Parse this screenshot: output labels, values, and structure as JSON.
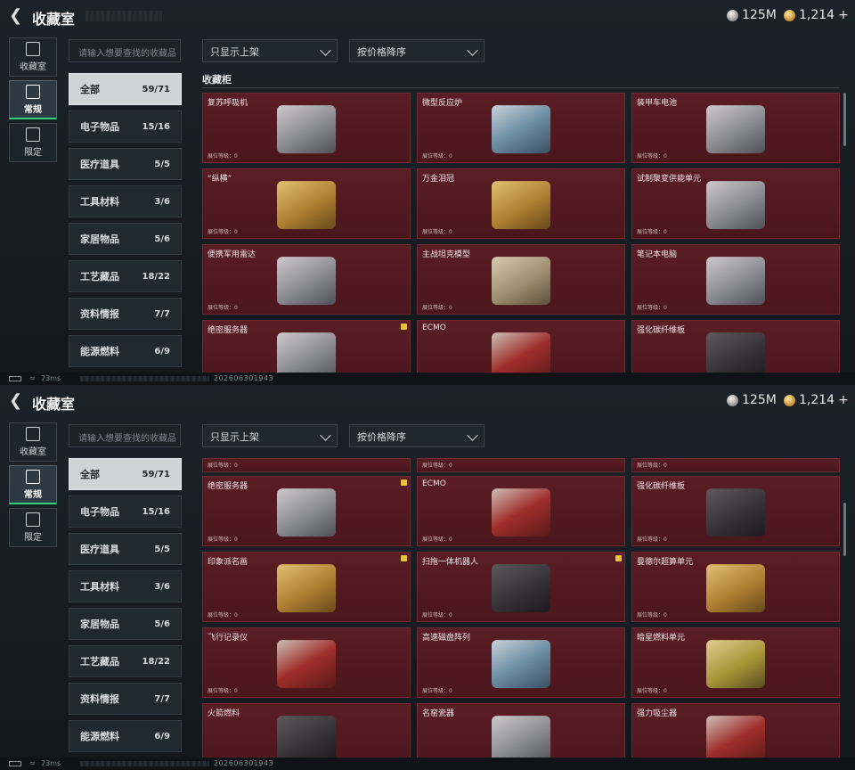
{
  "header": {
    "title": "收藏室",
    "silver": "125M",
    "gold": "1,214"
  },
  "rail": [
    {
      "label": "收藏室"
    },
    {
      "label": "常规"
    },
    {
      "label": "限定"
    }
  ],
  "search": {
    "placeholder": "请输入想要查找的收藏品"
  },
  "filters": {
    "shelf": "只显示上架",
    "sort": "按价格降序"
  },
  "categories": [
    {
      "name": "全部",
      "count": "59/71"
    },
    {
      "name": "电子物品",
      "count": "15/16"
    },
    {
      "name": "医疗道具",
      "count": "5/5"
    },
    {
      "name": "工具材料",
      "count": "3/6"
    },
    {
      "name": "家居物品",
      "count": "5/6"
    },
    {
      "name": "工艺藏品",
      "count": "18/22"
    },
    {
      "name": "资料情报",
      "count": "7/7"
    },
    {
      "name": "能源燃料",
      "count": "6/9"
    }
  ],
  "cabinet_label": "收藏柜",
  "level_label": "展位等级：0",
  "top_items": [
    "复苏呼吸机",
    "微型反应炉",
    "装甲车电池",
    "“纵横”",
    "万金泪冠",
    "试制聚变供能单元",
    "便携军用雷达",
    "主战坦克模型",
    "笔记本电脑",
    "绝密服务器",
    "ECMO",
    "强化碳纤维板"
  ],
  "bottom_items": [
    "绝密服务器",
    "ECMO",
    "强化碳纤维板",
    "印象派名画",
    "扫拖一体机器人",
    "曼德尔超算单元",
    "飞行记录仪",
    "高速磁盘阵列",
    "暗星燃料单元",
    "火箭燃料",
    "名窑瓷器",
    "强力吸尘器"
  ],
  "status": {
    "ping": "73ms",
    "code": "20260630194З"
  }
}
